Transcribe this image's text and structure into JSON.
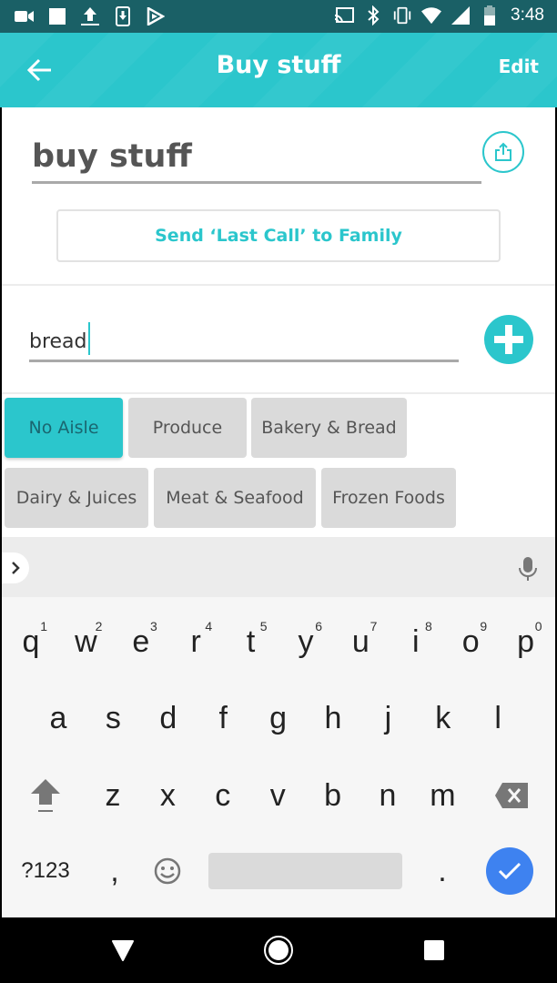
{
  "status_bar": {
    "time": "3:48",
    "left_icons": [
      "video-camera-icon",
      "square-notification-icon",
      "upload-icon",
      "download-phone-icon",
      "play-store-icon"
    ],
    "right_icons": [
      "cast-icon",
      "bluetooth-icon",
      "vibrate-icon",
      "wifi-icon",
      "cell-signal-icon",
      "battery-icon"
    ]
  },
  "app_bar": {
    "back_icon": "arrow-left-icon",
    "title": "Buy stuff",
    "edit_label": "Edit",
    "color": "#2bc6cc"
  },
  "list": {
    "name": "buy stuff",
    "share_icon": "share-icon",
    "last_call_label": "Send ‘Last Call’ to Family"
  },
  "item_entry": {
    "value": "bread",
    "add_icon": "plus-icon"
  },
  "aisles": [
    {
      "label": "No Aisle",
      "active": true
    },
    {
      "label": "Produce",
      "active": false
    },
    {
      "label": "Bakery & Bread",
      "active": false
    },
    {
      "label": "Dairy & Juices",
      "active": false
    },
    {
      "label": "Meat & Seafood",
      "active": false
    },
    {
      "label": "Frozen Foods",
      "active": false
    }
  ],
  "keyboard": {
    "row1": [
      {
        "key": "q",
        "hint": "1"
      },
      {
        "key": "w",
        "hint": "2"
      },
      {
        "key": "e",
        "hint": "3"
      },
      {
        "key": "r",
        "hint": "4"
      },
      {
        "key": "t",
        "hint": "5"
      },
      {
        "key": "y",
        "hint": "6"
      },
      {
        "key": "u",
        "hint": "7"
      },
      {
        "key": "i",
        "hint": "8"
      },
      {
        "key": "o",
        "hint": "9"
      },
      {
        "key": "p",
        "hint": "0"
      }
    ],
    "row2": [
      "a",
      "s",
      "d",
      "f",
      "g",
      "h",
      "j",
      "k",
      "l"
    ],
    "row3": [
      "z",
      "x",
      "c",
      "v",
      "b",
      "n",
      "m"
    ],
    "symbols_label": "?123",
    "comma": ",",
    "period": ".",
    "accent_color": "#3e82f0"
  },
  "nav_bar": {
    "back_icon": "triangle-back-icon",
    "home_icon": "circle-home-icon",
    "recents_icon": "square-recents-icon"
  }
}
